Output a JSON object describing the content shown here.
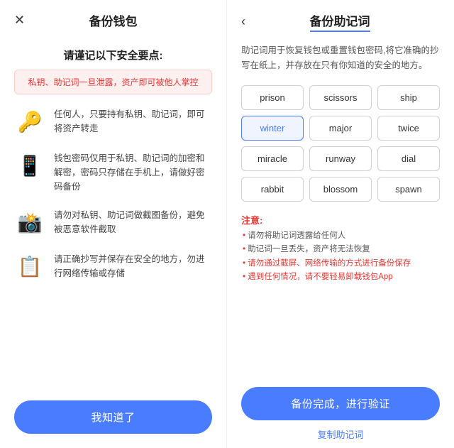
{
  "left": {
    "close_icon": "✕",
    "title": "备份钱包",
    "safety_heading": "请谨记以下安全要点:",
    "warning": "私钥、助记词一旦泄露，资产即可被他人掌控",
    "items": [
      {
        "icon": "🔑",
        "text": "任何人，只要持有私钥、助记词，即可将资产转走"
      },
      {
        "icon": "📱",
        "text": "钱包密码仅用于私钥、助记词的加密和解密，密码只存储在手机上，请做好密码备份"
      },
      {
        "icon": "📸",
        "text": "请勿对私钥、助记词做截图备份，避免被恶意软件截取"
      },
      {
        "icon": "📋",
        "text": "请正确抄写并保存在安全的地方，勿进行网络传输或存储"
      }
    ],
    "know_btn": "我知道了"
  },
  "right": {
    "back_icon": "‹",
    "title": "备份助记词",
    "description": "助记词用于恢复钱包或重置钱包密码,将它准确的抄写在纸上，并存放在只有你知道的安全的地方。",
    "words": [
      {
        "word": "prison",
        "highlighted": false
      },
      {
        "word": "scissors",
        "highlighted": false
      },
      {
        "word": "ship",
        "highlighted": false
      },
      {
        "word": "winter",
        "highlighted": true
      },
      {
        "word": "major",
        "highlighted": false
      },
      {
        "word": "twice",
        "highlighted": false
      },
      {
        "word": "miracle",
        "highlighted": false
      },
      {
        "word": "runway",
        "highlighted": false
      },
      {
        "word": "dial",
        "highlighted": false
      },
      {
        "word": "rabbit",
        "highlighted": false
      },
      {
        "word": "blossom",
        "highlighted": false
      },
      {
        "word": "spawn",
        "highlighted": false
      }
    ],
    "notes_title": "注意:",
    "notes": [
      {
        "text": "请勿将助记词透露给任何人",
        "red": false
      },
      {
        "text": "助记词一旦丢失，资产将无法恢复",
        "red": false
      },
      {
        "text": "请勿通过截屏、网络传输的方式进行备份保存",
        "red": true
      },
      {
        "text": "遇到任何情况，请不要轻易卸载钱包App",
        "red": true
      }
    ],
    "backup_btn": "备份完成，进行验证",
    "copy_link": "复制助记词"
  }
}
